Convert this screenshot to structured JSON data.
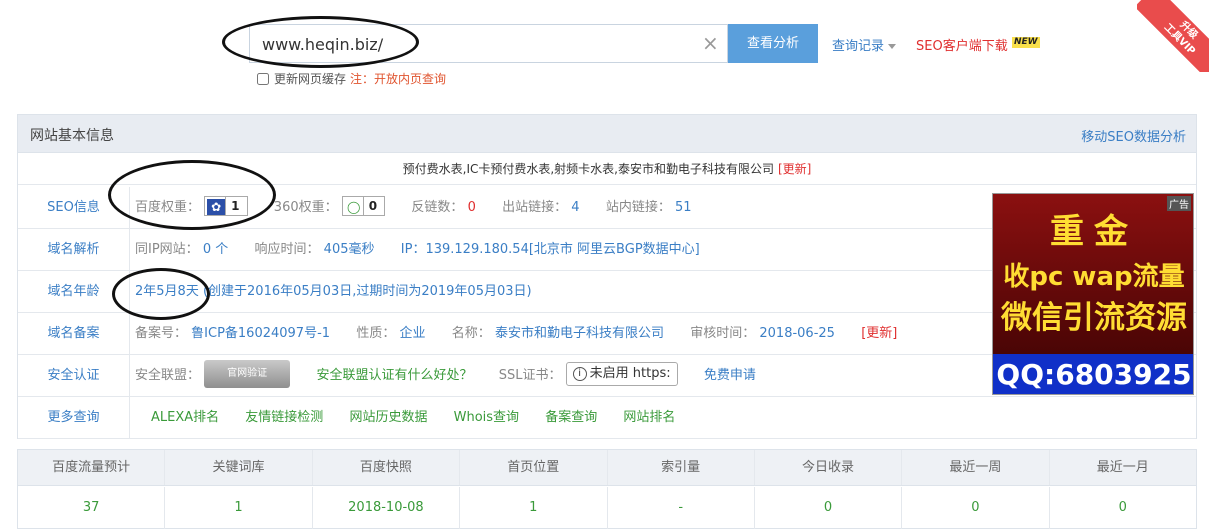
{
  "search": {
    "url": "www.heqin.biz/",
    "analyze_label": "查看分析",
    "history_label": "查询记录",
    "client_label": "SEO客户端下载",
    "new_badge": "NEW",
    "refresh_label": "更新网页缓存",
    "refresh_note": "注：开放内页查询"
  },
  "vip": {
    "line1": "升级",
    "line2": "工具VIP"
  },
  "panel": {
    "title": "网站基本信息",
    "mobile_link": "移动SEO数据分析",
    "site_title": "预付费水表,IC卡预付费水表,射频卡水表,泰安市和勤电子科技有限公司",
    "update_label": "[更新]"
  },
  "seo": {
    "label": "SEO信息",
    "baidu_label": "百度权重：",
    "baidu_value": "1",
    "r360_label": "360权重：",
    "r360_value": "0",
    "backlinks_label": "反链数：",
    "backlinks_value": "0",
    "outlinks_label": "出站链接：",
    "outlinks_value": "4",
    "inlinks_label": "站内链接：",
    "inlinks_value": "51"
  },
  "dns": {
    "label": "域名解析",
    "sameip_label": "同IP网站：",
    "sameip_value": "0 个",
    "resp_label": "响应时间：",
    "resp_value": "405毫秒",
    "ip_label": "IP：",
    "ip_value": "139.129.180.54[北京市 阿里云BGP数据中心]"
  },
  "age": {
    "label": "域名年龄",
    "value": "2年5月8天",
    "detail": "(创建于2016年05月03日,过期时间为2019年05月03日)"
  },
  "icp": {
    "label": "域名备案",
    "no_label": "备案号：",
    "no_value": "鲁ICP备16024097号-1",
    "type_label": "性质：",
    "type_value": "企业",
    "name_label": "名称：",
    "name_value": "泰安市和勤电子科技有限公司",
    "date_label": "审核时间：",
    "date_value": "2018-06-25",
    "update_label": "[更新]"
  },
  "security": {
    "label": "安全认证",
    "union_label": "安全联盟：",
    "badge_text": "官网验证",
    "union_link": "安全联盟认证有什么好处？",
    "ssl_label": "SSL证书：",
    "ssl_value": "未启用 https:",
    "ssl_apply": "免费申请"
  },
  "more": {
    "label": "更多查询",
    "links": [
      "ALEXA排名",
      "友情链接检测",
      "网站历史数据",
      "Whois查询",
      "备案查询",
      "网站排名"
    ]
  },
  "ad": {
    "tag": "广告",
    "line1": "重金",
    "line2": "收pc wap流量",
    "line3": "微信引流资源",
    "qq": "QQ:6803925"
  },
  "stats": {
    "headers": [
      "百度流量预计",
      "关键词库",
      "百度快照",
      "首页位置",
      "索引量",
      "今日收录",
      "最近一周",
      "最近一月"
    ],
    "values": [
      "37",
      "1",
      "2018-10-08",
      "1",
      "-",
      "0",
      "0",
      "0"
    ]
  }
}
